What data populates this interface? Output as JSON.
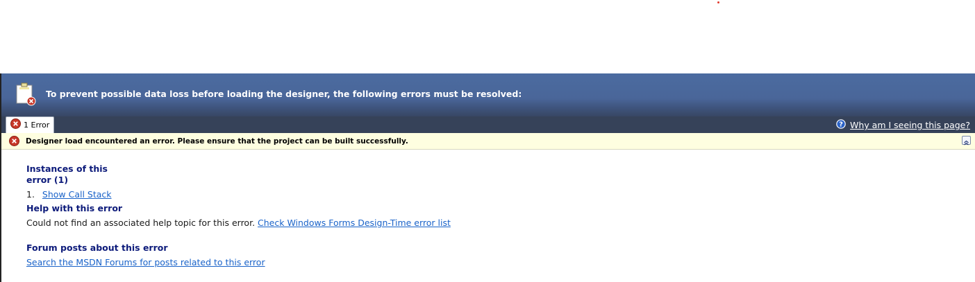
{
  "banner": {
    "message": "To prevent possible data loss before loading the designer, the following errors must be resolved:",
    "icon": "document-error-icon"
  },
  "tabs": {
    "error_tab_label": "1 Error",
    "why_link": "Why am I seeing this page?"
  },
  "error_bar": {
    "message": "Designer load encountered an error.  Please ensure that the project can be built successfully."
  },
  "sections": {
    "instances": {
      "title": "Instances of this error (1)",
      "item_number": "1.",
      "item_link": "Show Call Stack"
    },
    "help": {
      "title": "Help with this error",
      "text": "Could not find an associated help topic for this error.",
      "link": "Check Windows Forms Design-Time error list"
    },
    "forum": {
      "title": "Forum posts about this error",
      "link": "Search the MSDN Forums for posts related to this error"
    }
  },
  "colors": {
    "banner": "#4a6699",
    "tabbar": "#364259",
    "error_bar": "#fefee0",
    "section_title": "#0c1a7a",
    "link": "#1a63c9",
    "error_icon": "#c8382a"
  }
}
